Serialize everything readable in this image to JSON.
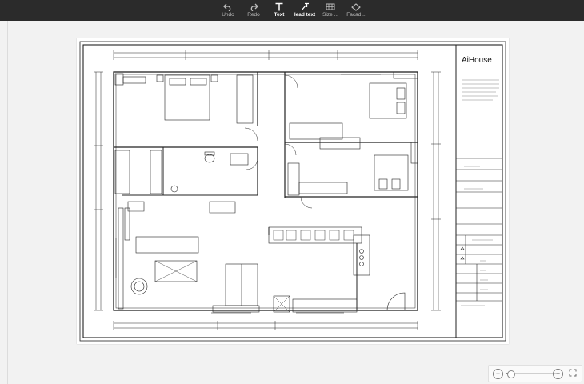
{
  "toolbar": {
    "items": [
      {
        "label": "Undo",
        "icon": "undo-icon"
      },
      {
        "label": "Redo",
        "icon": "redo-icon"
      },
      {
        "label": "Text",
        "icon": "text-icon"
      },
      {
        "label": "lead text",
        "icon": "lead-text-icon"
      },
      {
        "label": "Size ...",
        "icon": "size-icon"
      },
      {
        "label": "Facad...",
        "icon": "facade-icon"
      }
    ]
  },
  "sheet": {
    "brand": "AiHouse"
  },
  "zoom": {
    "level": 0.08,
    "minus": "−",
    "plus": "+"
  },
  "colors": {
    "toolbar_bg": "#2b2b2b",
    "canvas_bg": "#f2f2f2",
    "sheet_bg": "#ffffff",
    "line": "#222222"
  }
}
